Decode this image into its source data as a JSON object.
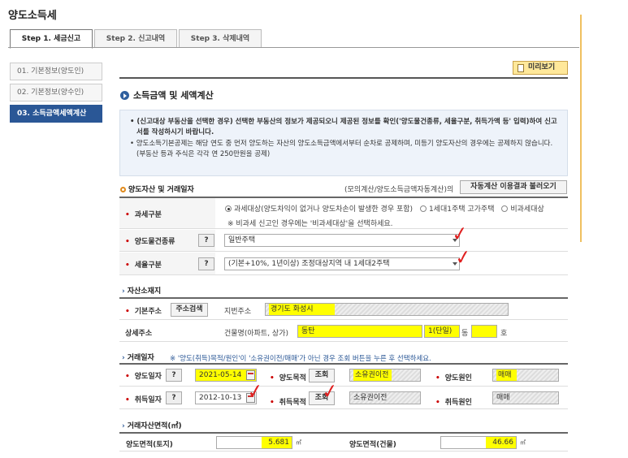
{
  "page": {
    "title": "양도소득세"
  },
  "tabs": [
    {
      "label": "Step 1. 세금신고"
    },
    {
      "label": "Step 2. 신고내역"
    },
    {
      "label": "Step 3. 삭제내역"
    }
  ],
  "sidebar": {
    "items": [
      {
        "label": "01. 기본정보(양도인)"
      },
      {
        "label": "02. 기본정보(양수인)"
      },
      {
        "label": "03. 소득금액세액계산"
      }
    ]
  },
  "preview_button": "미리보기",
  "section": {
    "title": "소득금액 및 세액계산",
    "notice": {
      "line1": "(신고대상 부동산을 선택한 경우) 선택한 부동산의 정보가 제공되오니 제공된 정보를 확인('양도물건종류, 세율구분, 취득가액 등' 입력)하여 신고서를 작성하시기 바랍니다.",
      "line2": "양도소득기본공제는 해당 연도 중 먼저 양도하는 자산의 양도소득금액에서부터 순차로 공제하며, 미등기 양도자산의 경우에는 공제하지 않습니다. (부동산 등과 주식은 각각 연 250만원을 공제)"
    }
  },
  "asset": {
    "title": "양도자산 및 거래일자",
    "mock_calc_text": "(모의계산/양도소득금액자동계산)의",
    "load_button": "자동계산 이용결과 불러오기",
    "tax_category": {
      "label": "과세구분",
      "options": [
        "과세대상(양도차익이 없거나 양도차손이 발생한 경우 포함)",
        "1세대1주택 고가주택",
        "비과세대상"
      ],
      "note": "※ 비과세 신고인 경우에는 '비과세대상'을 선택하세요."
    },
    "property_type": {
      "label": "양도물건종류",
      "help": "?",
      "value": "일반주택"
    },
    "tax_rate": {
      "label": "세율구분",
      "help": "?",
      "value": "(기본+10%, 1년이상) 조정대상지역 내 1세대2주택"
    }
  },
  "location": {
    "title": "자산소재지",
    "basic_address": {
      "label": "기본주소",
      "search_button": "주소검색",
      "lot_label": "지번주소",
      "lot_value": "경기도 화성시"
    },
    "detail_address": {
      "label": "상세주소",
      "building_label": "건물명(아파트, 상가)",
      "building_value": "동탄",
      "complex_value": "1(단일)",
      "dong_suffix": "동",
      "ho_suffix": "호"
    }
  },
  "transaction": {
    "title": "거래일자",
    "note": "※ '양도(취득)목적/원인'이 '소유권이전/매매'가 아닌 경우 조회 버튼을 누른 후 선택하세요.",
    "transfer_date": {
      "label": "양도일자",
      "help": "?",
      "value": "2021-05-14"
    },
    "transfer_purpose": {
      "label": "양도목적",
      "button": "조회",
      "value": "소유권이전"
    },
    "transfer_cause": {
      "label": "양도원인",
      "value": "매매"
    },
    "acquire_date": {
      "label": "취득일자",
      "help": "?",
      "value": "2012-10-13"
    },
    "acquire_purpose": {
      "label": "취득목적",
      "button": "조회",
      "value": "소유권이전"
    },
    "acquire_cause": {
      "label": "취득원인",
      "value": "매매"
    }
  },
  "area": {
    "title": "거래자산면적(㎡)",
    "land_label": "양도면적(토지)",
    "land_value": "5.681",
    "building_label": "양도면적(건물)",
    "building_value": "46.66",
    "unit": "㎡"
  },
  "colors": {
    "accent_blue": "#2a5796",
    "highlight": "#ffff00",
    "check_red": "#e02020"
  }
}
